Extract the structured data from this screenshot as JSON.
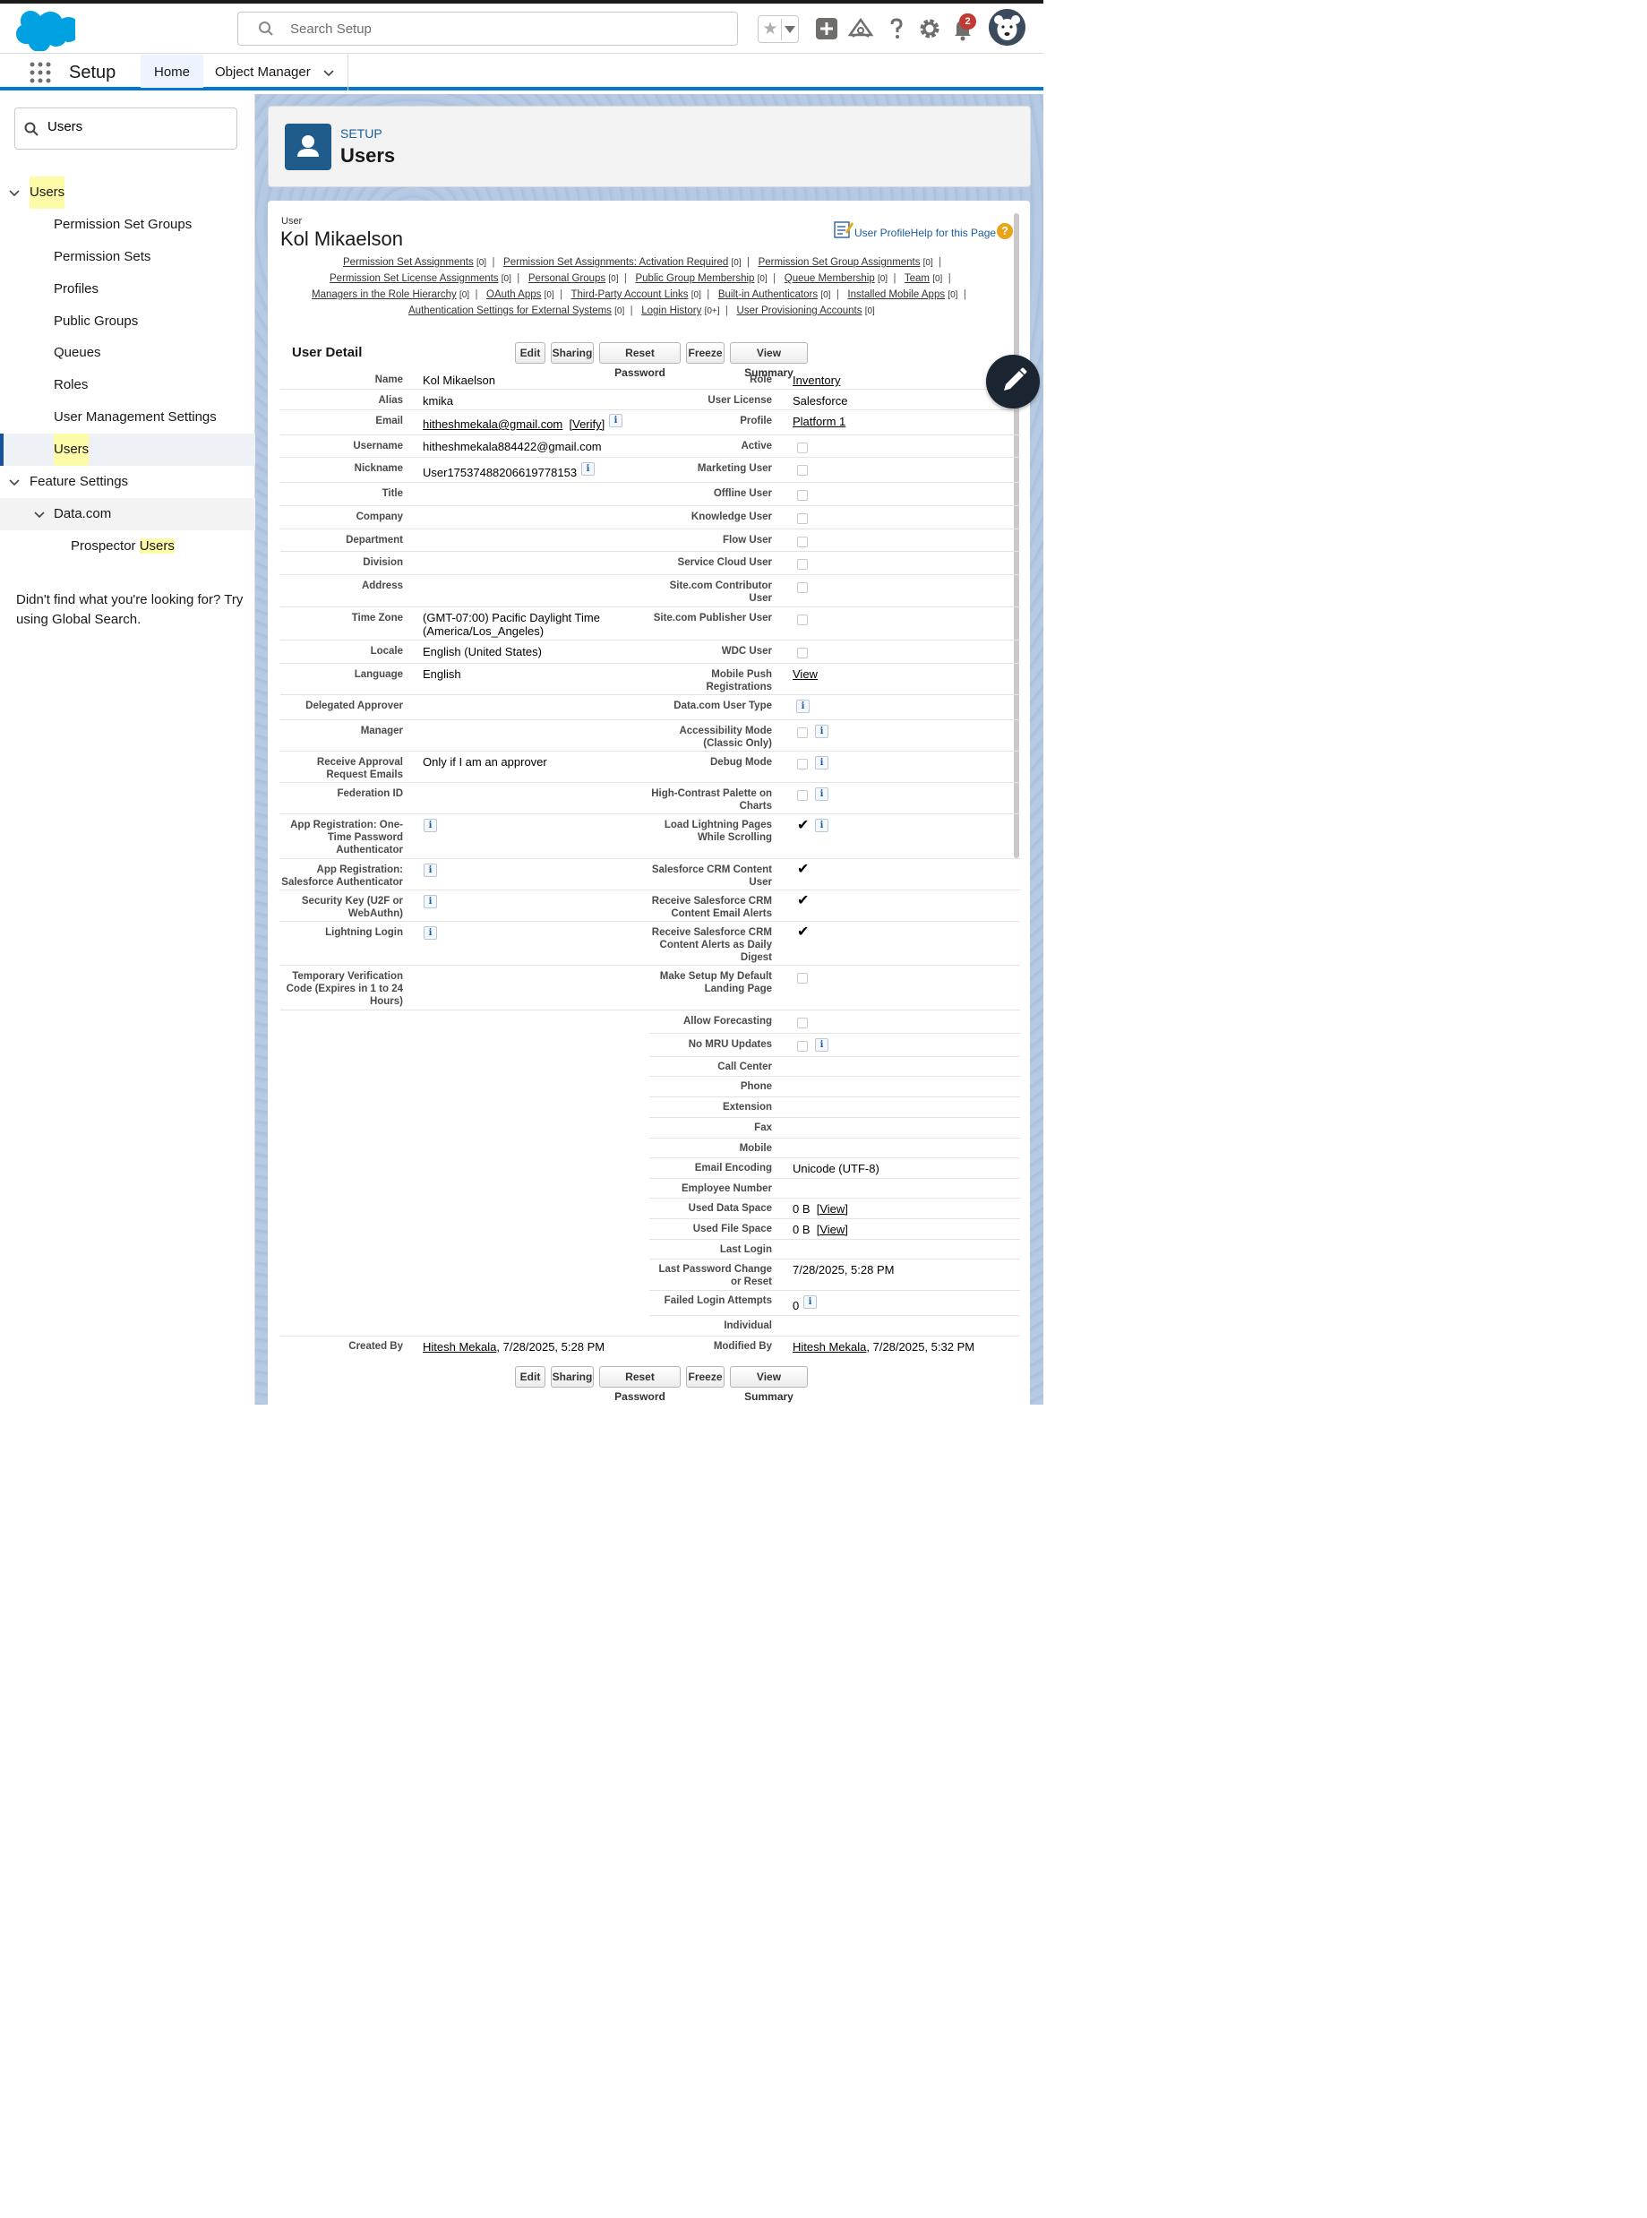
{
  "header": {
    "search_placeholder": "Search Setup",
    "notification_count": "2"
  },
  "nav": {
    "app_name": "Setup",
    "tabs": [
      {
        "label": "Home"
      },
      {
        "label": "Object Manager"
      }
    ]
  },
  "sidebar": {
    "quick_find_value": "Users",
    "tree": {
      "users_group": "Users",
      "items": [
        "Permission Set Groups",
        "Permission Sets",
        "Profiles",
        "Public Groups",
        "Queues",
        "Roles",
        "User Management Settings",
        "Users"
      ],
      "feature_settings": "Feature Settings",
      "datacom": "Data.com",
      "prospector_prefix": "Prospector ",
      "prospector_hl": "Users"
    },
    "not_found_text": "Didn't find what you're looking for? Try using Global Search."
  },
  "page_header": {
    "breadcrumb": "SETUP",
    "title": "Users"
  },
  "user": {
    "label": "User",
    "name": "Kol Mikaelson",
    "help_link": "User ProfileHelp for this Page"
  },
  "related_links": [
    [
      [
        "Permission Set Assignments",
        "[0]"
      ],
      [
        "Permission Set Assignments: Activation Required",
        "[0]"
      ],
      [
        "Permission Set Group Assignments",
        "[0]"
      ]
    ],
    [
      [
        "Permission Set License Assignments",
        "[0]"
      ],
      [
        "Personal Groups",
        "[0]"
      ],
      [
        "Public Group Membership",
        "[0]"
      ],
      [
        "Queue Membership",
        "[0]"
      ],
      [
        "Team",
        "[0]"
      ]
    ],
    [
      [
        "Managers in the Role Hierarchy",
        "[0]"
      ],
      [
        "OAuth Apps",
        "[0]"
      ],
      [
        "Third-Party Account Links",
        "[0]"
      ],
      [
        "Built-in Authenticators",
        "[0]"
      ],
      [
        "Installed Mobile Apps",
        "[0]"
      ]
    ],
    [
      [
        "Authentication Settings for External Systems",
        "[0]"
      ],
      [
        "Login History",
        "[0+]"
      ],
      [
        "User Provisioning Accounts",
        "[0]"
      ]
    ]
  ],
  "detail": {
    "title": "User Detail",
    "buttons": [
      "Edit",
      "Sharing",
      "Reset Password",
      "Freeze",
      "View Summary"
    ],
    "verify_label": "[Verify]",
    "view_label": "[View]",
    "info_glyph": "i",
    "check_glyph": "✔",
    "left": {
      "name": {
        "label": "Name",
        "value": "Kol Mikaelson"
      },
      "alias": {
        "label": "Alias",
        "value": "kmika"
      },
      "email": {
        "label": "Email",
        "value": "hitheshmekala@gmail.com"
      },
      "username": {
        "label": "Username",
        "value": "hitheshmekala884422@gmail.com"
      },
      "nickname": {
        "label": "Nickname",
        "value": "User17537488206619778153"
      },
      "title": {
        "label": "Title"
      },
      "company": {
        "label": "Company"
      },
      "department": {
        "label": "Department"
      },
      "division": {
        "label": "Division"
      },
      "address": {
        "label": "Address"
      },
      "timezone": {
        "label": "Time Zone",
        "value1": "(GMT-07:00) Pacific Daylight Time",
        "value2": "(America/Los_Angeles)"
      },
      "locale": {
        "label": "Locale",
        "value": "English (United States)"
      },
      "language": {
        "label": "Language",
        "value": "English"
      },
      "delegated": {
        "label": "Delegated Approver"
      },
      "manager": {
        "label": "Manager"
      },
      "approval": {
        "label1": "Receive Approval",
        "label2": "Request Emails",
        "value": "Only if I am an approver"
      },
      "federation": {
        "label": "Federation ID"
      },
      "otp": {
        "label1": "App Registration: One-",
        "label2": "Time Password",
        "label3": "Authenticator"
      },
      "sfauth": {
        "label1": "App Registration:",
        "label2": "Salesforce Authenticator"
      },
      "seckey": {
        "label1": "Security Key (U2F or",
        "label2": "WebAuthn)"
      },
      "lightning_login": {
        "label": "Lightning Login"
      },
      "tempcode": {
        "label1": "Temporary Verification",
        "label2": "Code (Expires in 1 to 24",
        "label3": "Hours)"
      },
      "created_by": {
        "label": "Created By",
        "user": "Hitesh Mekala",
        "date": ", 7/28/2025, 5:28 PM"
      }
    },
    "right": {
      "role": {
        "label": "Role",
        "value": "Inventory"
      },
      "license": {
        "label": "User License",
        "value": "Salesforce"
      },
      "profile": {
        "label": "Profile",
        "value": "Platform 1"
      },
      "active": {
        "label": "Active"
      },
      "marketing": {
        "label": "Marketing User"
      },
      "offline": {
        "label": "Offline User"
      },
      "knowledge": {
        "label": "Knowledge User"
      },
      "flow": {
        "label": "Flow User"
      },
      "service_cloud": {
        "label": "Service Cloud User"
      },
      "site_contrib": {
        "label1": "Site.com Contributor",
        "label2": "User"
      },
      "site_pub": {
        "label": "Site.com Publisher User"
      },
      "wdc": {
        "label": "WDC User"
      },
      "mobile_push": {
        "label1": "Mobile Push",
        "label2": "Registrations",
        "value": "View"
      },
      "datacom_type": {
        "label": "Data.com User Type"
      },
      "accessibility": {
        "label1": "Accessibility Mode",
        "label2": "(Classic Only)"
      },
      "debug": {
        "label": "Debug Mode"
      },
      "high_contrast": {
        "label1": "High-Contrast Palette on",
        "label2": "Charts"
      },
      "load_lightning": {
        "label1": "Load Lightning Pages",
        "label2": "While Scrolling"
      },
      "crm_content": {
        "label1": "Salesforce CRM Content",
        "label2": "User"
      },
      "crm_email": {
        "label1": "Receive Salesforce CRM",
        "label2": "Content Email Alerts"
      },
      "crm_digest": {
        "label1": "Receive Salesforce CRM",
        "label2": "Content Alerts as Daily",
        "label3": "Digest"
      },
      "setup_landing": {
        "label1": "Make Setup My Default",
        "label2": "Landing Page"
      },
      "forecasting": {
        "label": "Allow Forecasting"
      },
      "no_mru": {
        "label": "No MRU Updates"
      },
      "call_center": {
        "label": "Call Center"
      },
      "phone": {
        "label": "Phone"
      },
      "extension": {
        "label": "Extension"
      },
      "fax": {
        "label": "Fax"
      },
      "mobile": {
        "label": "Mobile"
      },
      "encoding": {
        "label": "Email Encoding",
        "value": "Unicode (UTF-8)"
      },
      "employee_no": {
        "label": "Employee Number"
      },
      "data_space": {
        "label": "Used Data Space",
        "value": "0 B"
      },
      "file_space": {
        "label": "Used File Space",
        "value": "0 B"
      },
      "last_login": {
        "label": "Last Login"
      },
      "last_pw": {
        "label1": "Last Password Change",
        "label2": "or Reset",
        "value": "7/28/2025, 5:28 PM"
      },
      "failed_login": {
        "label": "Failed Login Attempts",
        "value": "0"
      },
      "individual": {
        "label": "Individual"
      },
      "modified_by": {
        "label": "Modified By",
        "user": "Hitesh Mekala",
        "date": ", 7/28/2025, 5:32 PM"
      }
    }
  },
  "colors": {
    "brand_blue": "#0176d3",
    "header_icon_bg": "#1f5c8c",
    "badge_red": "#c23934",
    "highlight": "#fdfba8"
  }
}
